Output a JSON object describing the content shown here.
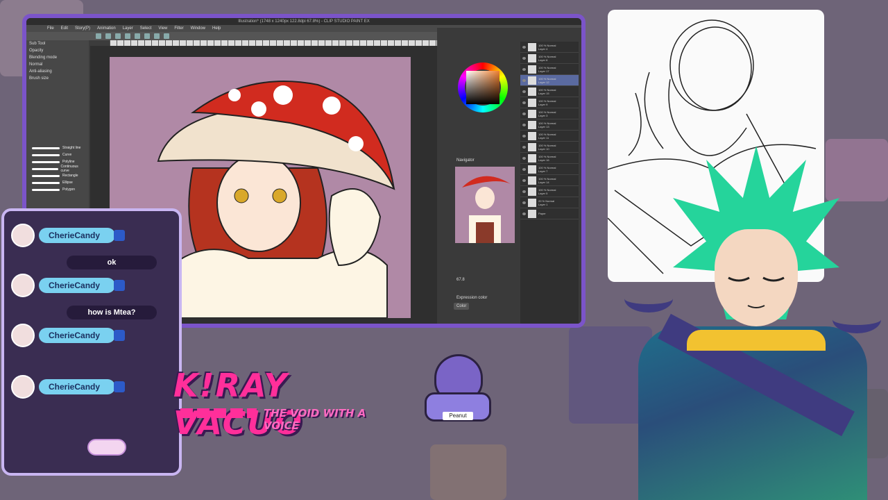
{
  "app": {
    "title": "Illustration* (1748 x 1240px 122.8dpi 67.8%) - CLIP STUDIO PAINT EX",
    "menu": [
      "File",
      "Edit",
      "Story(P)",
      "Animation",
      "Layer",
      "Select",
      "View",
      "Filter",
      "Window",
      "Help"
    ],
    "left_panel": {
      "header": "Sub Tool",
      "props": [
        "Opacity",
        "Blending mode",
        "Normal",
        "Anti-aliasing",
        "Brush size"
      ],
      "brushes": [
        "Straight line",
        "Curve",
        "Polyline",
        "Continuous curve",
        "Rectangle",
        "Ellipse",
        "Polygon"
      ]
    },
    "layers": [
      {
        "name": "Layer 4",
        "mode": "100 % Normal"
      },
      {
        "name": "Layer 8",
        "mode": "100 % Normal"
      },
      {
        "name": "Layer 17",
        "mode": "100 % Normal"
      },
      {
        "name": "Layer 12",
        "mode": "100 % Normal",
        "active": true
      },
      {
        "name": "Layer 15",
        "mode": "100 % Normal"
      },
      {
        "name": "Layer 9",
        "mode": "100 % Normal"
      },
      {
        "name": "Layer 3",
        "mode": "100 % Normal"
      },
      {
        "name": "Layer 13",
        "mode": "100 % Normal"
      },
      {
        "name": "Layer 11",
        "mode": "100 % Normal"
      },
      {
        "name": "Layer 10",
        "mode": "100 % Normal"
      },
      {
        "name": "Layer 16",
        "mode": "100 % Normal"
      },
      {
        "name": "Layer 7",
        "mode": "100 % Normal"
      },
      {
        "name": "Layer 14",
        "mode": "100 % Normal"
      },
      {
        "name": "Layer 5",
        "mode": "100 % Normal"
      },
      {
        "name": "Layer 1",
        "mode": "20 % Normal"
      },
      {
        "name": "Paper",
        "mode": ""
      }
    ],
    "navigator_label": "Navigator",
    "zoom": "67.8",
    "effect_label": "Expression color",
    "effect_value": "Color",
    "colors": {
      "canvas": "#b089a6",
      "frame": "#7b54c9"
    }
  },
  "chat": {
    "messages": [
      {
        "user": "CherieCandy",
        "text": "ok"
      },
      {
        "user": "CherieCandy",
        "text": "how is Mtea?"
      },
      {
        "user": "CherieCandy",
        "text": ""
      },
      {
        "user": "CherieCandy",
        "text": ""
      }
    ]
  },
  "logo": {
    "title": "K!RAY VACUO",
    "subtitle": "THE VOID WITH A VOICE"
  },
  "mascot": {
    "plate": "Peanut"
  }
}
